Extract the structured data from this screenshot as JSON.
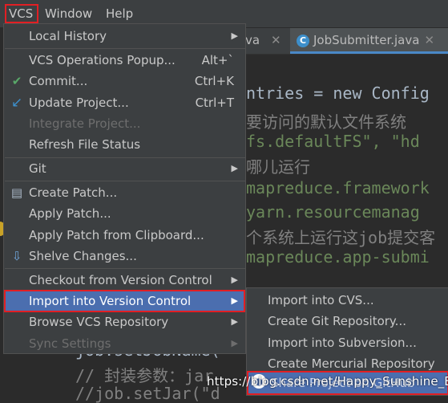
{
  "menubar": {
    "vcs": "VCS",
    "window": "Window",
    "help": "Help"
  },
  "tabs": {
    "prev_label": "va",
    "active_label": "JobSubmitter.java",
    "active_icon": "C"
  },
  "code_lines": [
    "ntries = new Config",
    "要访问的默认文件系统",
    "fs.defaultFS\", \"hd",
    "哪儿运行",
    "mapreduce.framework",
    "yarn.resourcemanag",
    "个系统上运行这job提交客",
    "mapreduce.app-submi"
  ],
  "code_tail": [
    "job.setJobName(",
    "// 封装参数：jar",
    "//job.setJar(\"d"
  ],
  "menu": {
    "local_history": "Local History",
    "ops_popup": "VCS Operations Popup...",
    "ops_popup_shortcut": "Alt+`",
    "commit": "Commit...",
    "commit_shortcut": "Ctrl+K",
    "update": "Update Project...",
    "update_shortcut": "Ctrl+T",
    "integrate": "Integrate Project...",
    "refresh": "Refresh File Status",
    "git": "Git",
    "create_patch": "Create Patch...",
    "apply_patch": "Apply Patch...",
    "apply_patch_clip": "Apply Patch from Clipboard...",
    "shelve": "Shelve Changes...",
    "checkout": "Checkout from Version Control",
    "import": "Import into Version Control",
    "browse": "Browse VCS Repository",
    "sync": "Sync Settings"
  },
  "submenu": {
    "cvs": "Import into CVS...",
    "git_repo": "Create Git Repository...",
    "subversion": "Import into Subversion...",
    "mercurial": "Create Mercurial Repository",
    "share_github": "Share Project on GitHub"
  },
  "watermark": "https://blog.csdn.net/Happy_Sunshine_Boy"
}
